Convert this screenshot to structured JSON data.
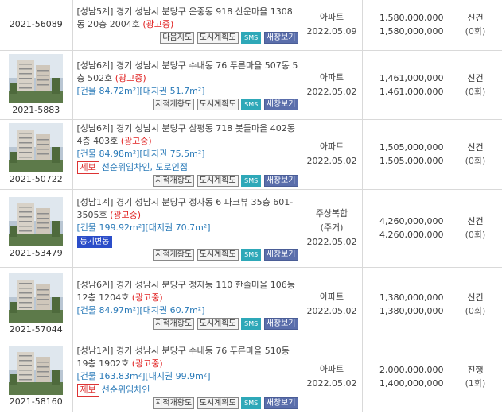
{
  "buttons": {
    "map": "다음지도",
    "cadastral": "지적개황도",
    "urban_plan": "도시계획도",
    "sms": "SMS",
    "new_window": "새창보기"
  },
  "rows": [
    {
      "case_no": "2021-56089",
      "has_photo": false,
      "region": "[성남5계]",
      "address": " 경기 성남시 분당구 운중동 918 산운마을 1308동 20층 2004호",
      "ad": " (광고중)",
      "area": "",
      "tags": [],
      "note": "",
      "first_button": "map",
      "type": [
        "아파트"
      ],
      "date": "2022.05.09",
      "appraisal": "1,580,000,000",
      "min_bid": "1,580,000,000",
      "status": "신건",
      "rounds": "(0회)"
    },
    {
      "case_no": "2021-5883",
      "has_photo": true,
      "region": "[성남6계]",
      "address": " 경기 성남시 분당구 수내동 76 푸른마을 507동 5층 502호",
      "ad": " (광고중)",
      "area": "[건물 84.72m²][대지권 51.7m²]",
      "tags": [],
      "note": "",
      "first_button": "cadastral",
      "type": [
        "아파트"
      ],
      "date": "2022.05.02",
      "appraisal": "1,461,000,000",
      "min_bid": "1,461,000,000",
      "status": "신건",
      "rounds": "(0회)"
    },
    {
      "case_no": "2021-50722",
      "has_photo": true,
      "region": "[성남6계]",
      "address": " 경기 성남시 분당구 삼평동 718 봇들마을 402동 4층 403호",
      "ad": " (광고중)",
      "area": "[건물 84.98m²][대지권 75.5m²]",
      "tags": [
        {
          "kind": "red",
          "label": "제보"
        }
      ],
      "note": "선순위임차인, 도로인접",
      "first_button": "cadastral",
      "type": [
        "아파트"
      ],
      "date": "2022.05.02",
      "appraisal": "1,505,000,000",
      "min_bid": "1,505,000,000",
      "status": "신건",
      "rounds": "(0회)"
    },
    {
      "case_no": "2021-53479",
      "has_photo": true,
      "region": "[성남1계]",
      "address": " 경기 성남시 분당구 정자동 6 파크뷰 35층 601-3505호",
      "ad": " (광고중)",
      "area": "[건물 199.92m²][대지권 70.7m²]",
      "tags": [
        {
          "kind": "blue",
          "label": "등기변동"
        }
      ],
      "note": "",
      "first_button": "cadastral",
      "type": [
        "주상복합",
        "(주거)"
      ],
      "date": "2022.05.02",
      "appraisal": "4,260,000,000",
      "min_bid": "4,260,000,000",
      "status": "신건",
      "rounds": "(0회)"
    },
    {
      "case_no": "2021-57044",
      "has_photo": true,
      "region": "[성남6계]",
      "address": " 경기 성남시 분당구 정자동 110 한솔마을 106동 12층 1204호",
      "ad": " (광고중)",
      "area": "[건물 84.97m²][대지권 60.7m²]",
      "tags": [],
      "note": "",
      "first_button": "cadastral",
      "type": [
        "아파트"
      ],
      "date": "2022.05.02",
      "appraisal": "1,380,000,000",
      "min_bid": "1,380,000,000",
      "status": "신건",
      "rounds": "(0회)"
    },
    {
      "case_no": "2021-58160",
      "has_photo": true,
      "region": "[성남1계]",
      "address": " 경기 성남시 분당구 수내동 76 푸른마을 510동 19층 1902호",
      "ad": " (광고중)",
      "area": "[건물 163.83m²][대지권 99.9m²]",
      "tags": [
        {
          "kind": "red",
          "label": "제보"
        }
      ],
      "note": "선순위임차인",
      "first_button": "cadastral",
      "type": [
        "아파트"
      ],
      "date": "2022.05.02",
      "appraisal": "2,000,000,000",
      "min_bid": "1,400,000,000",
      "status": "진행",
      "rounds": "(1회)"
    }
  ]
}
